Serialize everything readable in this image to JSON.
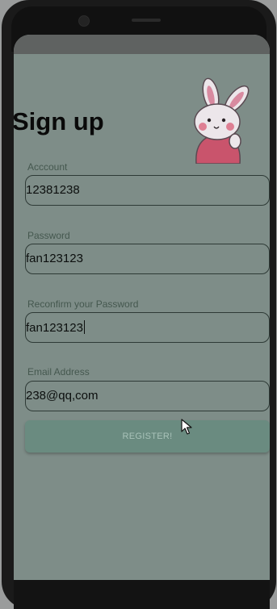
{
  "page": {
    "title": "Sign up"
  },
  "form": {
    "account": {
      "label": "Acccount",
      "value": "12381238"
    },
    "password": {
      "label": "Password",
      "value": "fan123123"
    },
    "confirm": {
      "label": "Reconfirm your Password",
      "value": "fan123123"
    },
    "email": {
      "label": "Email Address",
      "value": "238@qq,com"
    }
  },
  "actions": {
    "register_label": "REGISTER!"
  },
  "icons": {
    "mascot": "bunny-mascot-icon",
    "pointer": "mouse-pointer-icon"
  },
  "colors": {
    "overlay": "#7e8d88",
    "button": "#6a8b80",
    "button_text": "#a8c2b8"
  }
}
